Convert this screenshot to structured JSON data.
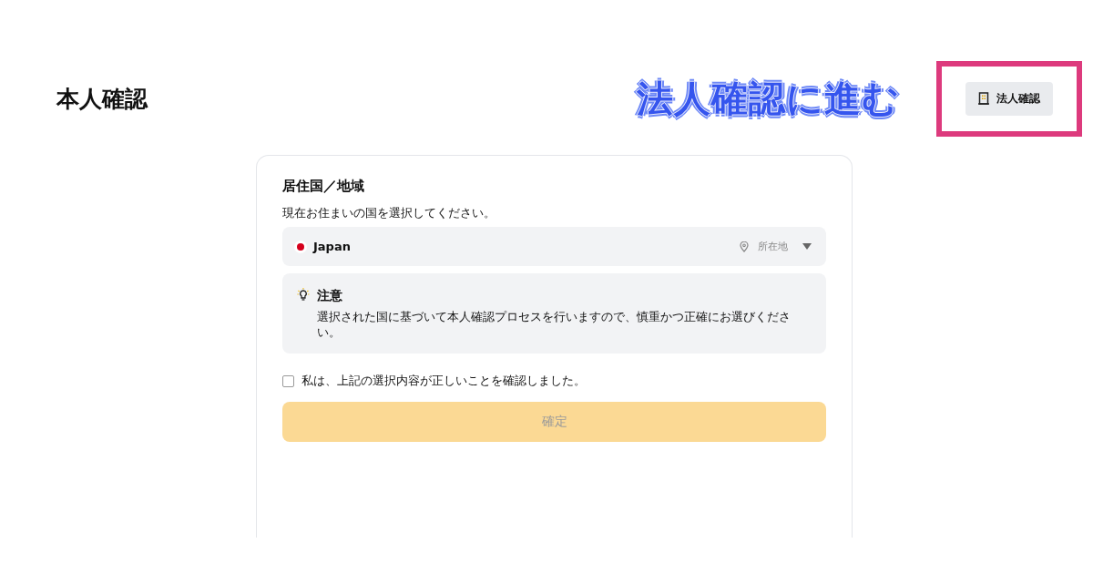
{
  "page_title": "本人確認",
  "annotation": {
    "text": "法人確認に進む"
  },
  "corporate_button": {
    "label": "法人確認",
    "highlighted": true
  },
  "card": {
    "title": "居住国／地域",
    "description": "現在お住まいの国を選択してください。",
    "country_select": {
      "value": "Japan",
      "hint": "所在地"
    },
    "notice": {
      "title": "注意",
      "body": "選択された国に基づいて本人確認プロセスを行いますので、慎重かつ正確にお選びください。"
    },
    "confirmation": {
      "label": "私は、上記の選択内容が正しいことを確認しました。",
      "checked": false
    },
    "submit": {
      "label": "確定",
      "disabled": true
    }
  }
}
